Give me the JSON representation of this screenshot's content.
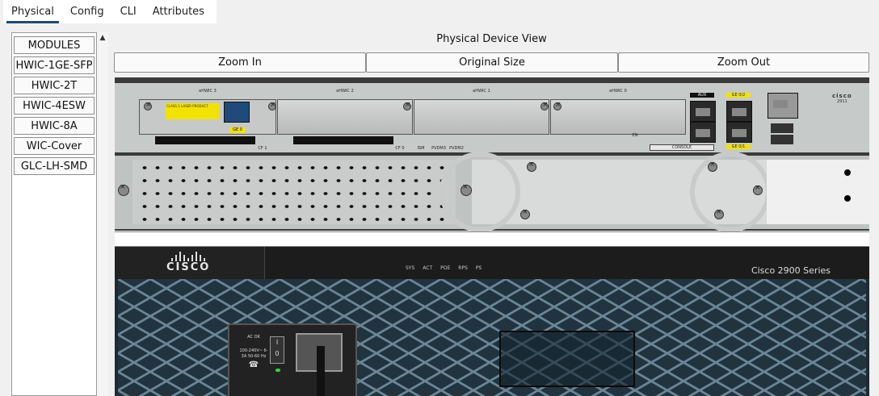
{
  "tabs": [
    {
      "label": "Physical",
      "active": true
    },
    {
      "label": "Config",
      "active": false
    },
    {
      "label": "CLI",
      "active": false
    },
    {
      "label": "Attributes",
      "active": false
    }
  ],
  "modules": {
    "items": [
      "MODULES",
      "HWIC-1GE-SFP",
      "HWIC-2T",
      "HWIC-4ESW",
      "HWIC-8A",
      "WIC-Cover",
      "GLC-LH-SMD"
    ]
  },
  "view": {
    "title": "Physical Device View",
    "zoom_in": "Zoom In",
    "original_size": "Original Size",
    "zoom_out": "Zoom Out"
  },
  "device_back": {
    "slots": [
      "eHWIC 3",
      "eHWIC 2",
      "eHWIC 1",
      "eHWIC 0"
    ],
    "labels": [
      "CF 1",
      "CF 0",
      "ISM",
      "PVDM3",
      "PVDM2",
      "AUX",
      "GE 0/2",
      "GE 0/1",
      "CONSOLE",
      "EN",
      "GE 0"
    ],
    "brand": "cisco",
    "model": "2911"
  },
  "device_front": {
    "brand": "CISCO",
    "leds": [
      "SYS",
      "ACT",
      "POE",
      "RPS",
      "PS"
    ],
    "series": "Cisco 2900 Series",
    "psu": {
      "status": "AC OK",
      "rating": "100-240V~ 6-3A 50-60 Hz",
      "switch_on": "I",
      "switch_off": "0"
    }
  },
  "colors": {
    "tab_underline": "#1e4a7a",
    "mesh": "#6a8696"
  }
}
